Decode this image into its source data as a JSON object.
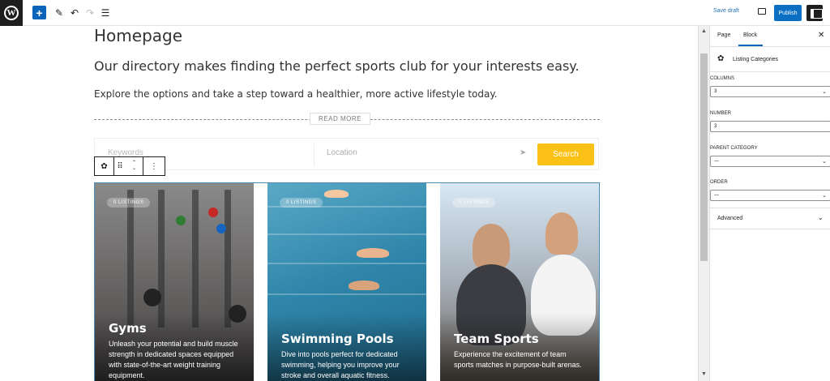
{
  "toolbar": {
    "save_draft": "Save draft",
    "publish": "Publish"
  },
  "editor": {
    "page_title": "Homepage",
    "lead": "Our directory makes finding the perfect sports club for your interests easy.",
    "description": "Explore the options and take a step toward a healthier, more active lifestyle today.",
    "read_more": "READ MORE",
    "search": {
      "keywords_placeholder": "Keywords",
      "location_placeholder": "Location",
      "button": "Search"
    },
    "cards": [
      {
        "badge": "0 LISTINGS",
        "title": "Gyms",
        "text": "Unleash your potential and build muscle strength in dedicated spaces equipped with state-of-the-art weight training equipment."
      },
      {
        "badge": "0 LISTINGS",
        "title": "Swimming Pools",
        "text": "Dive into pools perfect for dedicated swimming, helping you improve your stroke and overall aquatic fitness."
      },
      {
        "badge": "0 LISTINGS",
        "title": "Team Sports",
        "text": "Experience the excitement of team sports matches in purpose-built arenas."
      }
    ]
  },
  "sidebar": {
    "tabs": [
      "Page",
      "Block"
    ],
    "active_tab": "Block",
    "block_name": "Listing Categories",
    "fields": [
      {
        "label": "COLUMNS",
        "value": "3",
        "type": "select"
      },
      {
        "label": "NUMBER",
        "value": "3",
        "type": "input"
      },
      {
        "label": "PARENT CATEGORY",
        "value": "—",
        "type": "select"
      },
      {
        "label": "ORDER",
        "value": "—",
        "type": "select"
      }
    ],
    "advanced": "Advanced"
  },
  "colors": {
    "accent": "#0a64b9",
    "search_button": "#fcc116",
    "admin_dark": "#1e1e1e"
  }
}
